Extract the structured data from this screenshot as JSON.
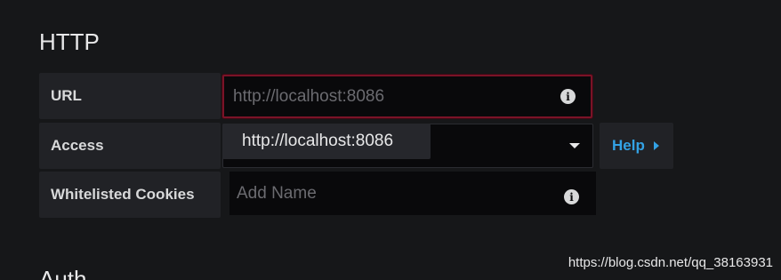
{
  "section": {
    "title": "HTTP",
    "next_title": "Auth"
  },
  "url": {
    "label": "URL",
    "placeholder": "http://localhost:8086",
    "value": ""
  },
  "access": {
    "label": "Access",
    "option": "http://localhost:8086"
  },
  "help": {
    "label": "Help"
  },
  "cookies": {
    "label": "Whitelisted Cookies",
    "placeholder": "Add Name"
  },
  "info_glyph": "i",
  "watermark": "https://blog.csdn.net/qq_38163931",
  "colors": {
    "background": "#161719",
    "label_bg": "#212226",
    "input_bg": "#09090b",
    "invalid_border": "#7a1327",
    "accent": "#33a2e5"
  }
}
